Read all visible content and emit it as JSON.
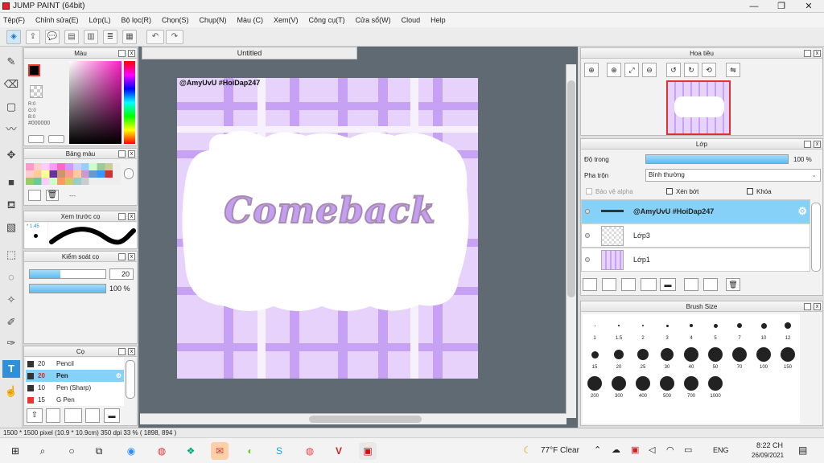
{
  "window": {
    "title": "JUMP PAINT (64bit)",
    "minimize": "—",
    "maximize": "❐",
    "close": "✕"
  },
  "menu": [
    "Tệp(F)",
    "Chỉnh sửa(E)",
    "Lớp(L)",
    "Bộ lọc(R)",
    "Chọn(S)",
    "Chụp(N)",
    "Màu (C)",
    "Xem(V)",
    "Công cụ(T)",
    "Cửa sổ(W)",
    "Cloud",
    "Help"
  ],
  "panels": {
    "color": {
      "title": "Màu",
      "r": "R:0",
      "g": "G:0",
      "b": "B:0",
      "hex": "#000000"
    },
    "palette": {
      "title": "Bảng màu",
      "dash": "---"
    },
    "preview": {
      "title": "Xem trước cọ",
      "value": "* 1.45"
    },
    "control": {
      "title": "Kiểm soát cọ",
      "size": "20",
      "opacity": "100 %"
    },
    "brush": {
      "title": "Cọ",
      "items": [
        {
          "size": "20",
          "name": "Pencil"
        },
        {
          "size": "20",
          "name": "Pen"
        },
        {
          "size": "10",
          "name": "Pen (Sharp)"
        },
        {
          "size": "15",
          "name": "G Pen"
        }
      ]
    },
    "navigator": {
      "title": "Hoa tiêu"
    },
    "layer": {
      "title": "Lớp",
      "opacity_label": "Độ trong",
      "opacity_value": "100 %",
      "blend_label": "Pha trộn",
      "blend_value": "Bình thường",
      "protect_alpha": "Bảo vệ alpha",
      "clip": "Xén bớt",
      "lock": "Khóa",
      "layers": [
        "@AmyUvU #HoiDap247",
        "Lớp3",
        "Lớp1"
      ]
    },
    "brushsize": {
      "title": "Brush Size",
      "sizes": [
        "1",
        "1.5",
        "2",
        "3",
        "4",
        "5",
        "7",
        "10",
        "12",
        "15",
        "20",
        "25",
        "30",
        "40",
        "50",
        "70",
        "100",
        "150",
        "200",
        "300",
        "400",
        "500",
        "700",
        "1000"
      ]
    }
  },
  "document": {
    "tab": "Untitled",
    "watermark": "@AmyUvU #HoiDap247",
    "artwork_text": "Comeback"
  },
  "status": {
    "text": "1500 * 1500 pixel   (10.9 * 10.9cm)   350 dpi   33 %   ( 1898, 894 )"
  },
  "taskbar": {
    "weather": "77°F  Clear",
    "lang": "ENG",
    "time": "8:22 CH",
    "date": "26/09/2021"
  },
  "colors": {
    "accent": "#7dd0f7",
    "selected_row": "#86d1f8",
    "purple": "#c49ef2"
  }
}
